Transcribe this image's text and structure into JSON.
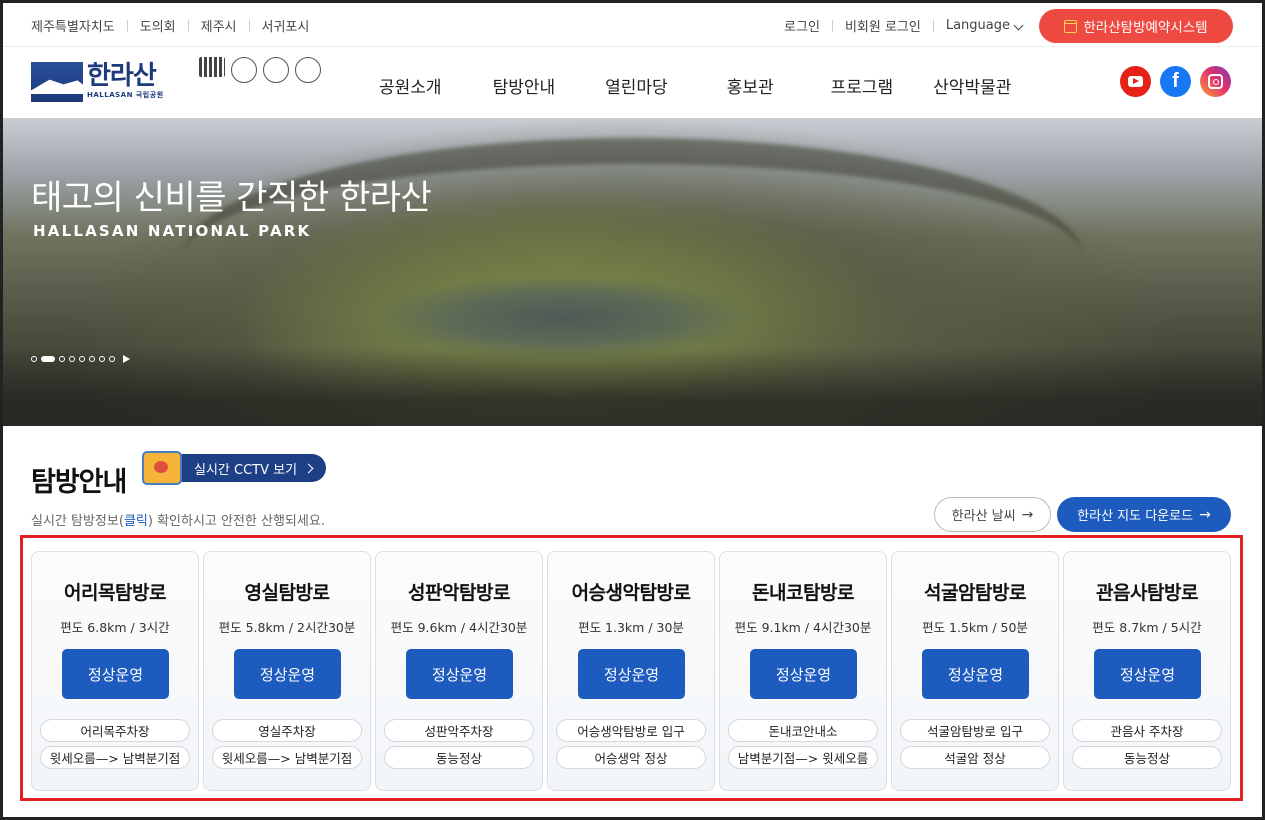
{
  "utility": {
    "left_links": [
      "제주특별자치도",
      "도의회",
      "제주시",
      "서귀포시"
    ],
    "login": "로그인",
    "guest_login": "비회원 로그인",
    "language": "Language",
    "reservation": "한라산탐방예약시스템"
  },
  "logo": {
    "korean": "한라산",
    "english": "HALLASAN 국립공원"
  },
  "nav": [
    "공원소개",
    "탐방안내",
    "열린마당",
    "홍보관",
    "프로그램",
    "산악박물관"
  ],
  "sns": [
    "youtube-icon",
    "facebook-icon",
    "instagram-icon"
  ],
  "hero": {
    "title": "태고의 신비를 간직한 한라산",
    "subtitle": "HALLASAN NATIONAL PARK",
    "slide_count": 8,
    "active_slide": 2
  },
  "section": {
    "title": "탐방안내",
    "cctv_button": "실시간 CCTV 보기",
    "desc_before": "실시간 탐방정보(",
    "desc_click": "클릭",
    "desc_after": ") 확인하시고 안전한 산행되세요.",
    "weather_button": "한라산 날씨",
    "map_button": "한라산 지도 다운로드"
  },
  "trails": [
    {
      "name": "어리목탐방로",
      "distance": "편도 6.8km / 3시간",
      "status": "정상운영",
      "points": [
        "어리목주차장",
        "윗세오름—> 남벽분기점"
      ]
    },
    {
      "name": "영실탐방로",
      "distance": "편도 5.8km / 2시간30분",
      "status": "정상운영",
      "points": [
        "영실주차장",
        "윗세오름—> 남벽분기점"
      ]
    },
    {
      "name": "성판악탐방로",
      "distance": "편도 9.6km / 4시간30분",
      "status": "정상운영",
      "points": [
        "성판악주차장",
        "동능정상"
      ]
    },
    {
      "name": "어승생악탐방로",
      "distance": "편도 1.3km / 30분",
      "status": "정상운영",
      "points": [
        "어승생악탐방로 입구",
        "어승생악 정상"
      ]
    },
    {
      "name": "돈내코탐방로",
      "distance": "편도 9.1km / 4시간30분",
      "status": "정상운영",
      "points": [
        "돈내코안내소",
        "남벽분기점—> 윗세오름"
      ]
    },
    {
      "name": "석굴암탐방로",
      "distance": "편도 1.5km / 50분",
      "status": "정상운영",
      "points": [
        "석굴암탐방로 입구",
        "석굴암 정상"
      ]
    },
    {
      "name": "관음사탐방로",
      "distance": "편도 8.7km / 5시간",
      "status": "정상운영",
      "points": [
        "관음사 주차장",
        "동능정상"
      ]
    }
  ]
}
